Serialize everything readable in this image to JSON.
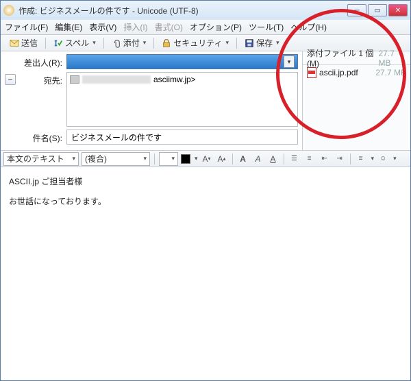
{
  "window": {
    "title": "作成: ビジネスメールの件です - Unicode (UTF-8)"
  },
  "menu": {
    "file": "ファイル(F)",
    "edit": "編集(E)",
    "view": "表示(V)",
    "insert": "挿入(I)",
    "format": "書式(O)",
    "options": "オプション(P)",
    "tools": "ツール(T)",
    "help": "ヘルプ(H)"
  },
  "toolbar": {
    "send": "送信",
    "spell": "スペル",
    "attach": "添付",
    "security": "セキュリティ",
    "save": "保存"
  },
  "labels": {
    "from": "差出人(R):",
    "to": "宛先:",
    "subject": "件名(S):"
  },
  "compose": {
    "from": " ",
    "to_display": "asciimw.jp>",
    "subject": "ビジネスメールの件です",
    "body_line1": "ASCII.jp  ご担当者様",
    "body_line2": "お世話になっております。"
  },
  "attach": {
    "header": "添付ファイル 1 個(M)",
    "total_size": "27.7 MB",
    "items": [
      {
        "name": "ascii.jp.pdf",
        "size": "27.7 MB"
      }
    ]
  },
  "format": {
    "textmode": "本文のテキスト",
    "font": "(複合)",
    "size": " "
  }
}
